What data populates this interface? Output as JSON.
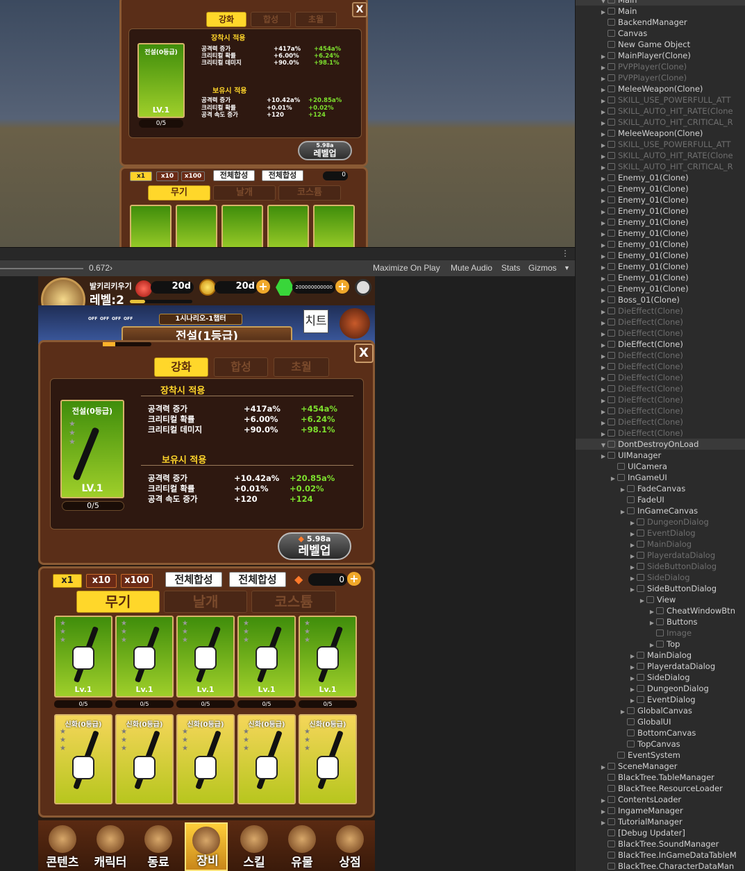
{
  "toolbar": {
    "scale_value": "0.672›",
    "maximize_label": "Maximize On Play",
    "mute_label": "Mute Audio",
    "stats_label": "Stats",
    "gizmos_label": "Gizmos"
  },
  "hierarchy": [
    {
      "label": "Main",
      "indent": 0,
      "arrow": true,
      "dim": false,
      "scene": true
    },
    {
      "label": "Main",
      "indent": 1,
      "arrow": true,
      "dim": false
    },
    {
      "label": "BackendManager",
      "indent": 1,
      "arrow": false,
      "dim": false
    },
    {
      "label": "Canvas",
      "indent": 1,
      "arrow": false,
      "dim": false
    },
    {
      "label": "New Game Object",
      "indent": 1,
      "arrow": false,
      "dim": false
    },
    {
      "label": "MainPlayer(Clone)",
      "indent": 1,
      "arrow": true,
      "dim": false
    },
    {
      "label": "PVPPlayer(Clone)",
      "indent": 1,
      "arrow": true,
      "dim": true
    },
    {
      "label": "PVPPlayer(Clone)",
      "indent": 1,
      "arrow": true,
      "dim": true
    },
    {
      "label": "MeleeWeapon(Clone)",
      "indent": 1,
      "arrow": true,
      "dim": false
    },
    {
      "label": "SKILL_USE_POWERFULL_ATT",
      "indent": 1,
      "arrow": true,
      "dim": true
    },
    {
      "label": "SKILL_AUTO_HIT_RATE(Clone",
      "indent": 1,
      "arrow": true,
      "dim": true
    },
    {
      "label": "SKILL_AUTO_HIT_CRITICAL_R",
      "indent": 1,
      "arrow": true,
      "dim": true
    },
    {
      "label": "MeleeWeapon(Clone)",
      "indent": 1,
      "arrow": true,
      "dim": false
    },
    {
      "label": "SKILL_USE_POWERFULL_ATT",
      "indent": 1,
      "arrow": true,
      "dim": true
    },
    {
      "label": "SKILL_AUTO_HIT_RATE(Clone",
      "indent": 1,
      "arrow": true,
      "dim": true
    },
    {
      "label": "SKILL_AUTO_HIT_CRITICAL_R",
      "indent": 1,
      "arrow": true,
      "dim": true
    },
    {
      "label": "Enemy_01(Clone)",
      "indent": 1,
      "arrow": true,
      "dim": false
    },
    {
      "label": "Enemy_01(Clone)",
      "indent": 1,
      "arrow": true,
      "dim": false
    },
    {
      "label": "Enemy_01(Clone)",
      "indent": 1,
      "arrow": true,
      "dim": false
    },
    {
      "label": "Enemy_01(Clone)",
      "indent": 1,
      "arrow": true,
      "dim": false
    },
    {
      "label": "Enemy_01(Clone)",
      "indent": 1,
      "arrow": true,
      "dim": false
    },
    {
      "label": "Enemy_01(Clone)",
      "indent": 1,
      "arrow": true,
      "dim": false
    },
    {
      "label": "Enemy_01(Clone)",
      "indent": 1,
      "arrow": true,
      "dim": false
    },
    {
      "label": "Enemy_01(Clone)",
      "indent": 1,
      "arrow": true,
      "dim": false
    },
    {
      "label": "Enemy_01(Clone)",
      "indent": 1,
      "arrow": true,
      "dim": false
    },
    {
      "label": "Enemy_01(Clone)",
      "indent": 1,
      "arrow": true,
      "dim": false
    },
    {
      "label": "Enemy_01(Clone)",
      "indent": 1,
      "arrow": true,
      "dim": false
    },
    {
      "label": "Boss_01(Clone)",
      "indent": 1,
      "arrow": true,
      "dim": false
    },
    {
      "label": "DieEffect(Clone)",
      "indent": 1,
      "arrow": true,
      "dim": true
    },
    {
      "label": "DieEffect(Clone)",
      "indent": 1,
      "arrow": true,
      "dim": true
    },
    {
      "label": "DieEffect(Clone)",
      "indent": 1,
      "arrow": true,
      "dim": true
    },
    {
      "label": "DieEffect(Clone)",
      "indent": 1,
      "arrow": true,
      "dim": false
    },
    {
      "label": "DieEffect(Clone)",
      "indent": 1,
      "arrow": true,
      "dim": true
    },
    {
      "label": "DieEffect(Clone)",
      "indent": 1,
      "arrow": true,
      "dim": true
    },
    {
      "label": "DieEffect(Clone)",
      "indent": 1,
      "arrow": true,
      "dim": true
    },
    {
      "label": "DieEffect(Clone)",
      "indent": 1,
      "arrow": true,
      "dim": true
    },
    {
      "label": "DieEffect(Clone)",
      "indent": 1,
      "arrow": true,
      "dim": true
    },
    {
      "label": "DieEffect(Clone)",
      "indent": 1,
      "arrow": true,
      "dim": true
    },
    {
      "label": "DieEffect(Clone)",
      "indent": 1,
      "arrow": true,
      "dim": true
    },
    {
      "label": "DieEffect(Clone)",
      "indent": 1,
      "arrow": true,
      "dim": true
    },
    {
      "label": "DontDestroyOnLoad",
      "indent": 0,
      "arrow": true,
      "dim": false,
      "scene": true
    },
    {
      "label": "UIManager",
      "indent": 1,
      "arrow": true,
      "dim": false
    },
    {
      "label": "UICamera",
      "indent": 2,
      "arrow": false,
      "dim": false
    },
    {
      "label": "InGameUI",
      "indent": 2,
      "arrow": true,
      "dim": false
    },
    {
      "label": "FadeCanvas",
      "indent": 3,
      "arrow": true,
      "dim": false
    },
    {
      "label": "FadeUI",
      "indent": 3,
      "arrow": false,
      "dim": false
    },
    {
      "label": "InGameCanvas",
      "indent": 3,
      "arrow": true,
      "dim": false
    },
    {
      "label": "DungeonDialog",
      "indent": 4,
      "arrow": true,
      "dim": true
    },
    {
      "label": "EventDialog",
      "indent": 4,
      "arrow": true,
      "dim": true
    },
    {
      "label": "MainDialog",
      "indent": 4,
      "arrow": true,
      "dim": true
    },
    {
      "label": "PlayerdataDialog",
      "indent": 4,
      "arrow": true,
      "dim": true
    },
    {
      "label": "SideButtonDialog",
      "indent": 4,
      "arrow": true,
      "dim": true
    },
    {
      "label": "SideDialog",
      "indent": 4,
      "arrow": true,
      "dim": true
    },
    {
      "label": "SideButtonDialog",
      "indent": 4,
      "arrow": true,
      "dim": false
    },
    {
      "label": "View",
      "indent": 5,
      "arrow": true,
      "dim": false
    },
    {
      "label": "CheatWindowBtn",
      "indent": 6,
      "arrow": true,
      "dim": false
    },
    {
      "label": "Buttons",
      "indent": 6,
      "arrow": true,
      "dim": false
    },
    {
      "label": "Image",
      "indent": 6,
      "arrow": false,
      "dim": true
    },
    {
      "label": "Top",
      "indent": 6,
      "arrow": true,
      "dim": false
    },
    {
      "label": "MainDialog",
      "indent": 4,
      "arrow": true,
      "dim": false
    },
    {
      "label": "PlayerdataDialog",
      "indent": 4,
      "arrow": true,
      "dim": false
    },
    {
      "label": "SideDialog",
      "indent": 4,
      "arrow": true,
      "dim": false
    },
    {
      "label": "DungeonDialog",
      "indent": 4,
      "arrow": true,
      "dim": false
    },
    {
      "label": "EventDialog",
      "indent": 4,
      "arrow": true,
      "dim": false
    },
    {
      "label": "GlobalCanvas",
      "indent": 3,
      "arrow": true,
      "dim": false
    },
    {
      "label": "GlobalUI",
      "indent": 3,
      "arrow": false,
      "dim": false
    },
    {
      "label": "BottomCanvas",
      "indent": 3,
      "arrow": false,
      "dim": false
    },
    {
      "label": "TopCanvas",
      "indent": 3,
      "arrow": false,
      "dim": false
    },
    {
      "label": "EventSystem",
      "indent": 2,
      "arrow": false,
      "dim": false
    },
    {
      "label": "SceneManager",
      "indent": 1,
      "arrow": true,
      "dim": false
    },
    {
      "label": "BlackTree.TableManager",
      "indent": 1,
      "arrow": false,
      "dim": false
    },
    {
      "label": "BlackTree.ResourceLoader",
      "indent": 1,
      "arrow": false,
      "dim": false
    },
    {
      "label": "ContentsLoader",
      "indent": 1,
      "arrow": true,
      "dim": false
    },
    {
      "label": "IngameManager",
      "indent": 1,
      "arrow": true,
      "dim": false
    },
    {
      "label": "TutorialManager",
      "indent": 1,
      "arrow": true,
      "dim": false
    },
    {
      "label": "[Debug Updater]",
      "indent": 1,
      "arrow": false,
      "dim": false
    },
    {
      "label": "BlackTree.SoundManager",
      "indent": 1,
      "arrow": false,
      "dim": false
    },
    {
      "label": "BlackTree.InGameDataTableM",
      "indent": 1,
      "arrow": false,
      "dim": false
    },
    {
      "label": "BlackTree.CharacterDataMan",
      "indent": 1,
      "arrow": false,
      "dim": false
    }
  ],
  "game": {
    "player_name": "발키리키우기",
    "level": "레벨:2",
    "potion_value": "20d",
    "gold_value": "20d",
    "gem_value": "200000000000",
    "chapter": "1시나리오-1챕터",
    "cheat_label": "치트",
    "skill_off_labels": [
      "OFF",
      "OFF",
      "OFF",
      "OFF"
    ],
    "dialog_title": "전설(1등급)",
    "tabs": [
      "강화",
      "합성",
      "초월"
    ],
    "equip_header": "장착시 적용",
    "own_header": "보유시 적용",
    "item_card_title": "전설(0등급)",
    "item_card_level": "LV.1",
    "item_progress": "0/5",
    "equip_stats": [
      {
        "name": "공격력 증가",
        "cur": "+417a%",
        "next": "+454a%"
      },
      {
        "name": "크리티컬 확률",
        "cur": "+6.00%",
        "next": "+6.24%"
      },
      {
        "name": "크리티컬 데미지",
        "cur": "+90.0%",
        "next": "+98.1%"
      }
    ],
    "own_stats": [
      {
        "name": "공격력 증가",
        "cur": "+10.42a%",
        "next": "+20.85a%"
      },
      {
        "name": "크리티컬 확률",
        "cur": "+0.01%",
        "next": "+0.02%"
      },
      {
        "name": "공격 속도 증가",
        "cur": "+120",
        "next": "+124"
      }
    ],
    "levelup_cost": "5.98a",
    "levelup_label": "레벨업",
    "multipliers": [
      "x1",
      "x10",
      "x100"
    ],
    "merge_all": "전체합성",
    "merge_all_2": "전체합성",
    "feather_count": "0",
    "category_tabs": [
      "무기",
      "날개",
      "코스튬"
    ],
    "grid_cards_row1": [
      {
        "level": "Lv.1",
        "progress": "0/5"
      },
      {
        "level": "Lv.1",
        "progress": "0/5"
      },
      {
        "level": "Lv.1",
        "progress": "0/5"
      },
      {
        "level": "Lv.1",
        "progress": "0/5"
      },
      {
        "level": "Lv.1",
        "progress": "0/5"
      }
    ],
    "grid_cards_row2": [
      "신화(0등급)",
      "신화(0등급)",
      "신화(0등급)",
      "신화(0등급)",
      "신화(0등급)"
    ],
    "nav": [
      "콘텐츠",
      "캐릭터",
      "동료",
      "장비",
      "스킬",
      "유물",
      "상점"
    ],
    "nav_active": 3
  },
  "scene_preview": {
    "tabs": [
      "강화",
      "합성",
      "초월"
    ],
    "equip_header": "장착시 적용",
    "own_header": "보유시 적용",
    "item_card_title": "전설(0등급)",
    "item_card_level": "LV.1",
    "item_progress": "0/5",
    "levelup_cost": "5.98a",
    "levelup_label": "레벨업",
    "multipliers": [
      "x1",
      "x10",
      "x100"
    ],
    "merge_all": "전체합성",
    "merge_all_2": "전체합성",
    "feather_count": "0",
    "category_tabs": [
      "무기",
      "날개",
      "코스튬"
    ]
  }
}
